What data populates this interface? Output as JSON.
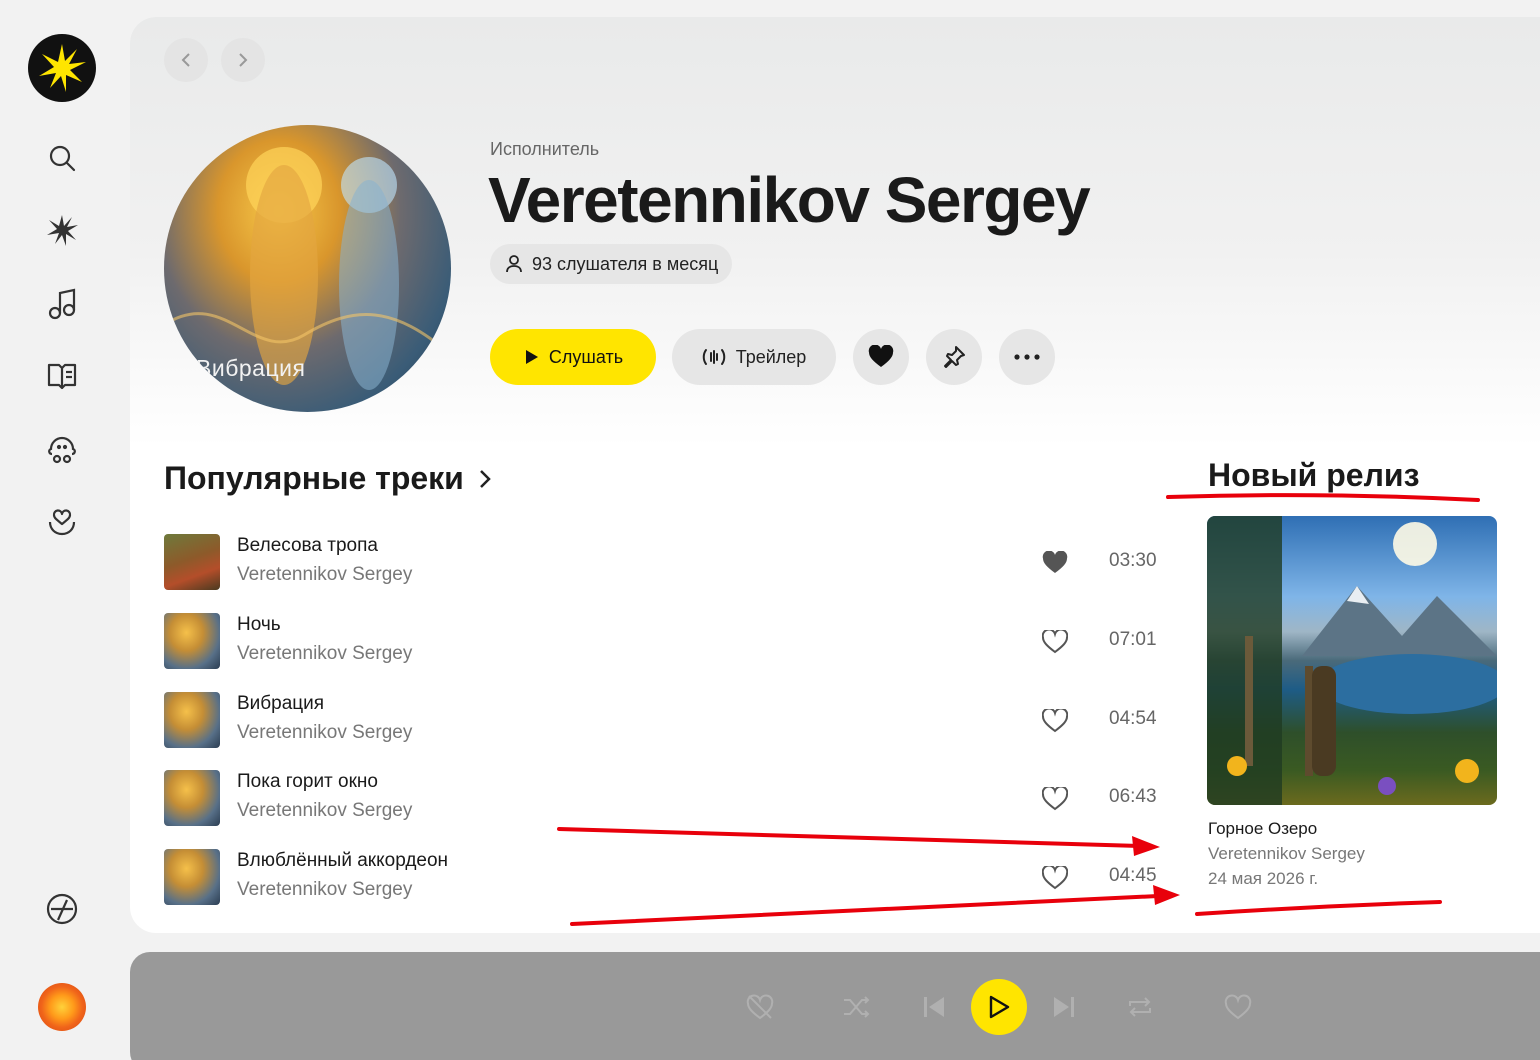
{
  "artist": {
    "kicker": "Исполнитель",
    "name": "Veretennikov Sergey",
    "listeners": "93 слушателя в месяц",
    "cover_caption": "Вибрация"
  },
  "actions": {
    "listen_label": "Слушать",
    "trailer_label": "Трейлер"
  },
  "popular": {
    "title": "Популярные треки",
    "tracks": [
      {
        "title": "Велесова тропа",
        "artist": "Veretennikov Sergey",
        "duration": "03:30",
        "liked": true
      },
      {
        "title": "Ночь",
        "artist": "Veretennikov Sergey",
        "duration": "07:01",
        "liked": false
      },
      {
        "title": "Вибрация",
        "artist": "Veretennikov Sergey",
        "duration": "04:54",
        "liked": false
      },
      {
        "title": "Пока горит окно",
        "artist": "Veretennikov Sergey",
        "duration": "06:43",
        "liked": false
      },
      {
        "title": "Влюблённый аккордеон",
        "artist": "Veretennikov Sergey",
        "duration": "04:45",
        "liked": false
      }
    ]
  },
  "new_release": {
    "title": "Новый релиз",
    "name": "Горное Озеро",
    "artist": "Veretennikov Sergey",
    "date": "24 мая 2026 г."
  },
  "colors": {
    "accent": "#ffe500",
    "annotation": "#e8000b",
    "player_bg": "#999999"
  },
  "icons": {
    "sidebar": [
      "search-icon",
      "wave-icon",
      "music-note-icon",
      "book-icon",
      "kids-icon",
      "heart-hands-icon",
      "compass-icon"
    ],
    "player": [
      "dislike-icon",
      "shuffle-icon",
      "previous-icon",
      "play-icon",
      "next-icon",
      "repeat-icon",
      "like-icon"
    ]
  }
}
